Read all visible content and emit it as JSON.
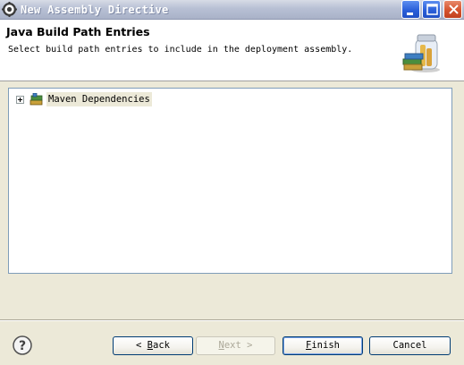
{
  "window": {
    "title": "New Assembly Directive",
    "icon": "eclipse-gear-icon"
  },
  "header": {
    "title": "Java Build Path Entries",
    "description": "Select build path entries to include in the deployment assembly.",
    "image": "jar-library-icon"
  },
  "tree": {
    "items": [
      {
        "label": "Maven Dependencies",
        "icon": "library-icon",
        "expanded": false
      }
    ]
  },
  "buttons": {
    "back": {
      "arrow": "<",
      "mnemonic": "B",
      "rest": "ack"
    },
    "next": {
      "mnemonic": "N",
      "rest": "ext",
      "arrow": ">"
    },
    "finish": {
      "mnemonic": "F",
      "rest": "inish"
    },
    "cancel": "Cancel"
  },
  "colors": {
    "dialog_bg": "#ece9d8",
    "title_bar": "#b8c0d4",
    "button_border": "#003c74"
  }
}
